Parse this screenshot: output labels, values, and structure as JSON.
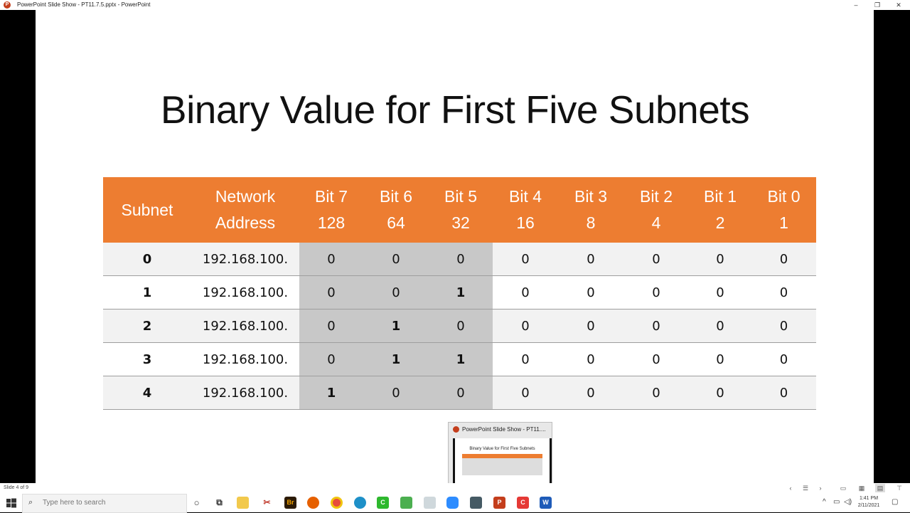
{
  "window": {
    "title": "PowerPoint Slide Show  -  PT11.7.5.pptx  -  PowerPoint",
    "minimize": "–",
    "restore": "❐",
    "close": "✕"
  },
  "slide": {
    "title": "Binary Value for First Five Subnets",
    "table": {
      "headers": [
        {
          "line1": "Subnet",
          "line2": ""
        },
        {
          "line1": "Network",
          "line2": "Address"
        },
        {
          "line1": "Bit 7",
          "line2": "128"
        },
        {
          "line1": "Bit 6",
          "line2": "64"
        },
        {
          "line1": "Bit 5",
          "line2": "32"
        },
        {
          "line1": "Bit 4",
          "line2": "16"
        },
        {
          "line1": "Bit 3",
          "line2": "8"
        },
        {
          "line1": "Bit 2",
          "line2": "4"
        },
        {
          "line1": "Bit 1",
          "line2": "2"
        },
        {
          "line1": "Bit 0",
          "line2": "1"
        }
      ],
      "rows": [
        [
          "0",
          "192.168.100.",
          "0",
          "0",
          "0",
          "0",
          "0",
          "0",
          "0",
          "0"
        ],
        [
          "1",
          "192.168.100.",
          "0",
          "0",
          "1",
          "0",
          "0",
          "0",
          "0",
          "0"
        ],
        [
          "2",
          "192.168.100.",
          "0",
          "1",
          "0",
          "0",
          "0",
          "0",
          "0",
          "0"
        ],
        [
          "3",
          "192.168.100.",
          "0",
          "1",
          "1",
          "0",
          "0",
          "0",
          "0",
          "0"
        ],
        [
          "4",
          "192.168.100.",
          "1",
          "0",
          "0",
          "0",
          "0",
          "0",
          "0",
          "0"
        ]
      ],
      "header_color": "#ed7d31",
      "highlight_color": "#c8c8c8"
    }
  },
  "statusbar": {
    "slide_info": "Slide 4 of 9"
  },
  "preview": {
    "title": "PowerPoint Slide Show  -  PT11....",
    "slide_title": "Binary Value for First Five Subnets"
  },
  "taskbar": {
    "search_placeholder": "Type here to search",
    "clock_time": "1:41 PM",
    "clock_date": "2/11/2021",
    "icons": [
      "cortana-icon",
      "task-view-icon",
      "file-explorer-icon",
      "snipping-icon",
      "bridge-icon",
      "firefox-icon",
      "chrome-icon",
      "edge-icon",
      "camtasia-icon",
      "app-icon",
      "window-icon",
      "zoom-icon",
      "calculator-icon",
      "powerpoint-icon",
      "camtasia-recorder-icon",
      "word-icon"
    ]
  }
}
